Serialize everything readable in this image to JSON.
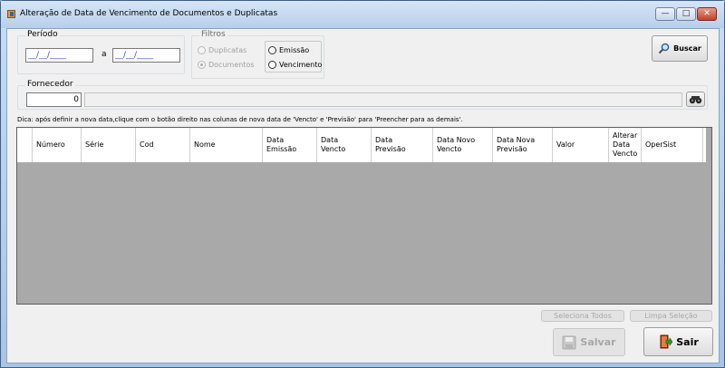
{
  "window": {
    "title": "Alteração de Data de Vencimento de Documentos e Duplicatas",
    "minimize_label": "—",
    "maximize_label": "□",
    "close_label": "✕"
  },
  "periodo": {
    "label": "Período",
    "date_start": "__/__/____",
    "separator": "a",
    "date_end": "__/__/____"
  },
  "filtros": {
    "label": "Filtros",
    "options": [
      {
        "label": "Duplicatas",
        "checked": false,
        "disabled": true
      },
      {
        "label": "Documentos",
        "checked": true,
        "disabled": true
      },
      {
        "label": "Emissão",
        "checked": false,
        "disabled": false
      },
      {
        "label": "Vencimento",
        "checked": false,
        "disabled": false
      }
    ]
  },
  "buscar": {
    "label": "Buscar"
  },
  "fornecedor": {
    "label": "Fornecedor",
    "code": "0",
    "name": ""
  },
  "hint": "Dica: após definir a nova data,clique com o botão direito nas colunas de nova data de 'Vencto' e 'Previsão' para 'Preencher para as demais'.",
  "grid": {
    "columns": [
      "Número",
      "Série",
      "Cod",
      "Nome",
      "Data\nEmissão",
      "Data\nVencto",
      "Data\nPrevisão",
      "Data Novo\nVencto",
      "Data Nova\nPrevisão",
      "Valor",
      "Alterar\nData\nVencto",
      "OperSist"
    ]
  },
  "buttons": {
    "seleciona_todos": "Seleciona Todos",
    "limpa_selecao": "Limpa Seleção",
    "salvar": "Salvar",
    "sair": "Sair"
  },
  "colors": {
    "date_text": "#2b4bd8",
    "grid_bg": "#a9a9a9",
    "window_bg": "#f0f0f0"
  }
}
